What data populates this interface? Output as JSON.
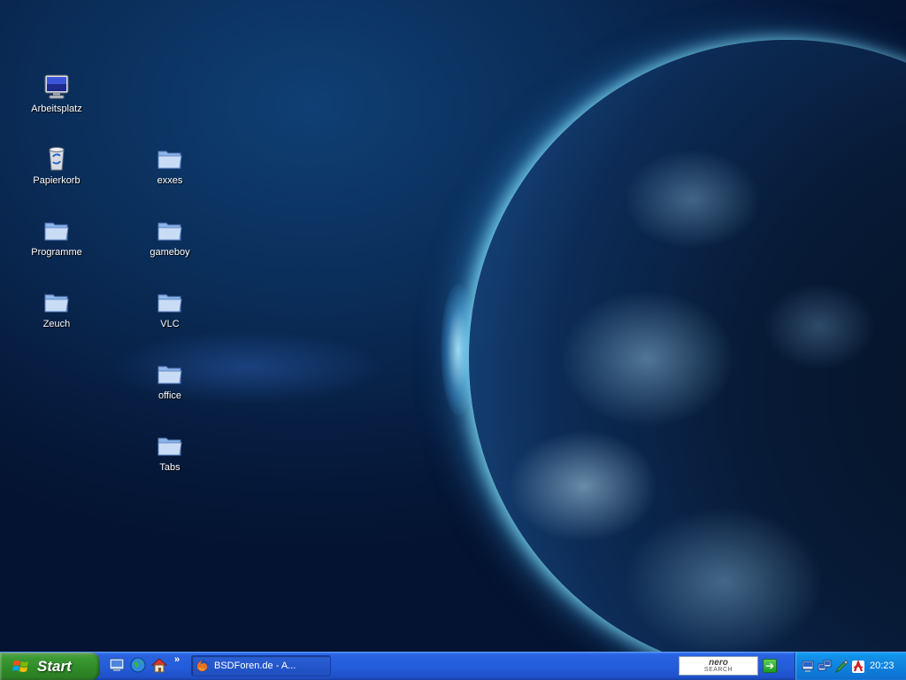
{
  "desktop": {
    "icons": [
      {
        "label": "Arbeitsplatz",
        "icon": "monitor-icon"
      },
      {
        "label": "Papierkorb",
        "icon": "recycle-bin-icon"
      },
      {
        "label": "Programme",
        "icon": "folder-icon"
      },
      {
        "label": "Zeuch",
        "icon": "folder-icon"
      },
      {
        "label": "exxes",
        "icon": "folder-icon"
      },
      {
        "label": "gameboy",
        "icon": "folder-icon"
      },
      {
        "label": "VLC",
        "icon": "folder-icon"
      },
      {
        "label": "office",
        "icon": "folder-icon"
      },
      {
        "label": "Tabs",
        "icon": "folder-icon"
      }
    ]
  },
  "taskbar": {
    "start_label": "Start",
    "quick_launch": [
      "show-desktop-icon",
      "browser-globe-icon",
      "home-icon"
    ],
    "quick_launch_more": "»",
    "tasks": [
      {
        "label": "BSDForen.de - A...",
        "icon": "firefox-icon"
      }
    ],
    "nero_search": {
      "logo": "nero",
      "sub": "SEARCH",
      "go": "➔"
    },
    "tray_icons": [
      "network-icon",
      "connection-icon",
      "pen-icon",
      "antivirus-icon"
    ],
    "clock": "20:23"
  },
  "colors": {
    "taskbar": "#245ddb",
    "start_button": "#3c9a33",
    "tray": "#0f7fdb"
  }
}
